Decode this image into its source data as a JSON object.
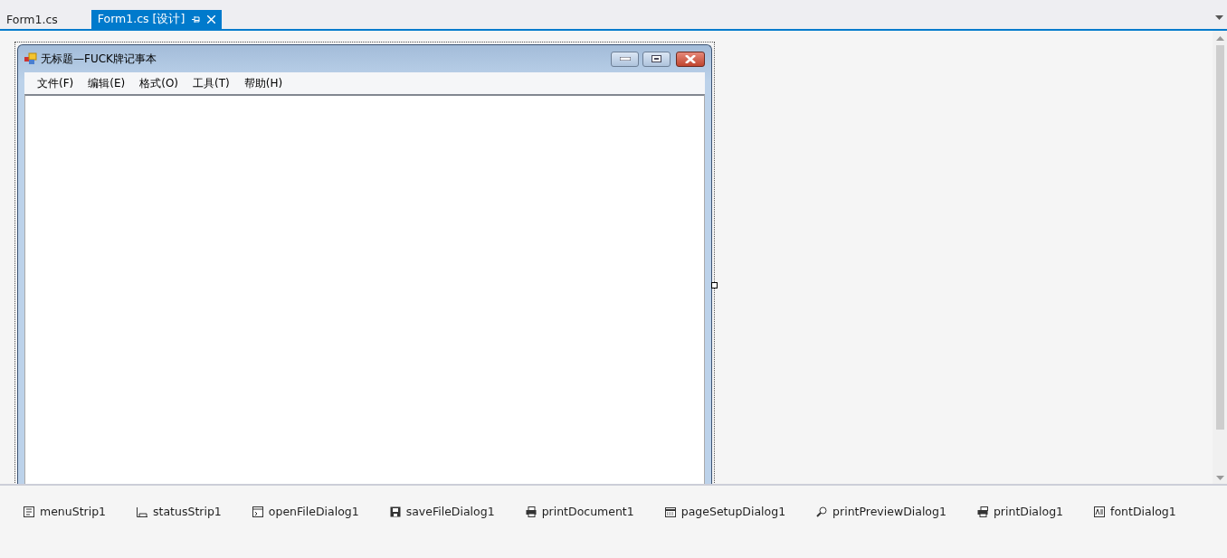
{
  "tabs": [
    {
      "label": "Form1.cs",
      "selected": false
    },
    {
      "label": "Form1.cs [设计]",
      "selected": true
    }
  ],
  "form": {
    "title": "无标题—FUCK牌记事本",
    "menu": [
      "文件(F)",
      "编辑(E)",
      "格式(O)",
      "工具(T)",
      "帮助(H)"
    ]
  },
  "components": [
    {
      "kind": "menu",
      "label": "menuStrip1"
    },
    {
      "kind": "status",
      "label": "statusStrip1"
    },
    {
      "kind": "open",
      "label": "openFileDialog1"
    },
    {
      "kind": "save",
      "label": "saveFileDialog1"
    },
    {
      "kind": "print",
      "label": "printDocument1"
    },
    {
      "kind": "pagesetup",
      "label": "pageSetupDialog1"
    },
    {
      "kind": "preview",
      "label": "printPreviewDialog1"
    },
    {
      "kind": "printdialog",
      "label": "printDialog1"
    },
    {
      "kind": "font",
      "label": "fontDialog1"
    }
  ]
}
